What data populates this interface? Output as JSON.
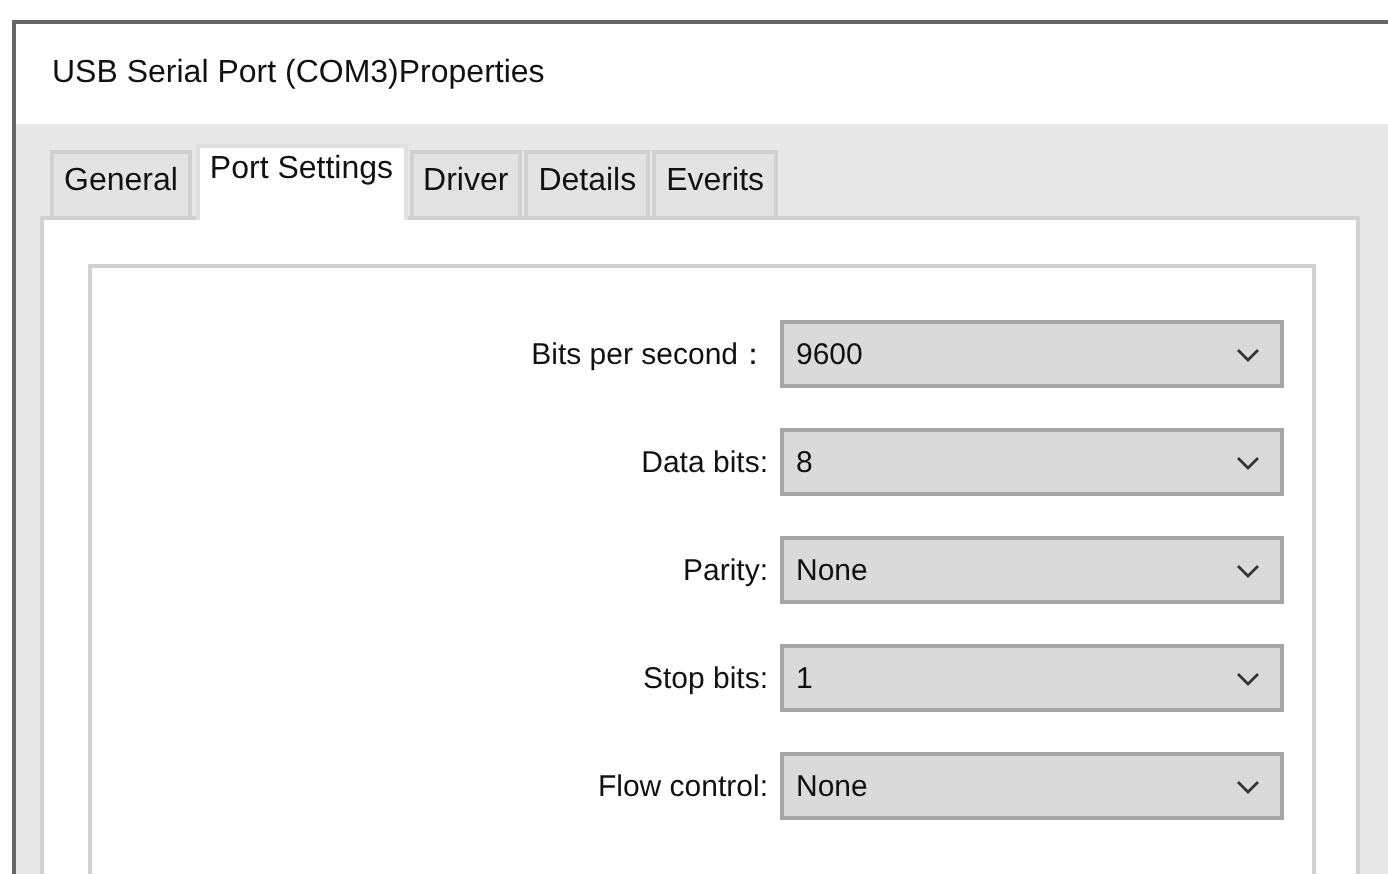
{
  "window": {
    "title": "USB Serial Port (COM3)Properties"
  },
  "tabs": [
    {
      "label": "General",
      "selected": false
    },
    {
      "label": "Port Settings",
      "selected": true
    },
    {
      "label": "Driver",
      "selected": false
    },
    {
      "label": "Details",
      "selected": false
    },
    {
      "label": "Everits",
      "selected": false
    }
  ],
  "settings": [
    {
      "label": "Bits per second：",
      "value": "9600"
    },
    {
      "label": "Data bits:",
      "value": "8"
    },
    {
      "label": "Parity:",
      "value": "None"
    },
    {
      "label": "Stop bits:",
      "value": "1"
    },
    {
      "label": "Flow control:",
      "value": "None"
    }
  ]
}
